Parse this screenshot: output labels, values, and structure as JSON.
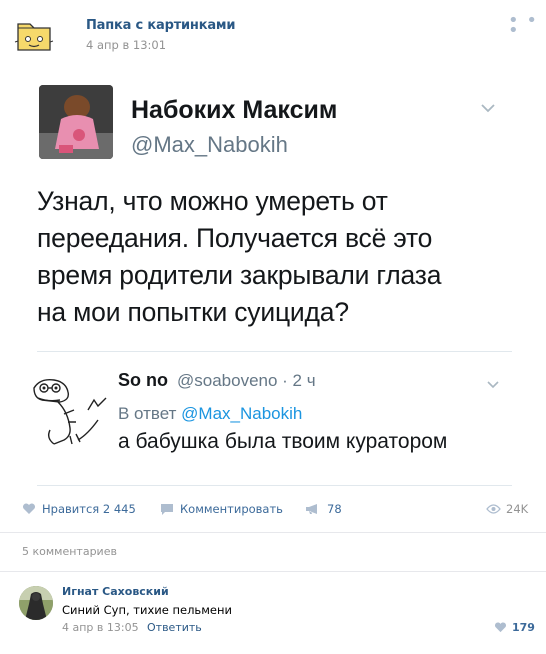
{
  "post": {
    "group_name": "Папка с картинками",
    "time": "4 апр в 13:01",
    "menu_icon": "more-dots-icon"
  },
  "tweet": {
    "name": "Набоких Максим",
    "handle": "@Max_Nabokih",
    "text_lines": [
      "Узнал, что можно умереть от",
      "переедания. Получается всё это",
      "время родители закрывали глаза",
      "на мои попытки суицида?"
    ],
    "reply": {
      "name": "So no",
      "handle": "@soaboveno · 2 ч",
      "in_reply_prefix": "В ответ ",
      "in_reply_mention": "@Max_Nabokih",
      "text": "а бабушка была твоим куратором"
    }
  },
  "actions": {
    "like_label": "Нравится 2 445",
    "comment_label": "Комментировать",
    "share_count": "78",
    "views": "24K"
  },
  "comments_header": "5 комментариев",
  "comment": {
    "author": "Игнат Саховский",
    "text": "Синий Суп, тихие пельмени",
    "time": "4 апр в 13:05",
    "reply_label": "Ответить",
    "likes": "179"
  },
  "colors": {
    "vk_link": "#2a5885",
    "twitter_blue": "#1b95e0",
    "muted": "#939393"
  }
}
